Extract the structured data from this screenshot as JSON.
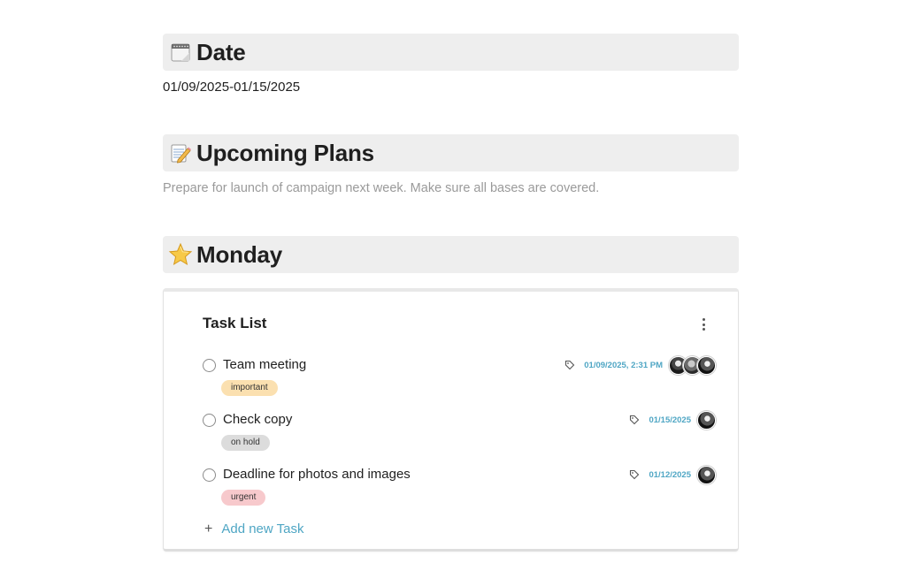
{
  "sections": {
    "date": {
      "title": "Date",
      "icon": "calendar-icon",
      "value": "01/09/2025-01/15/2025"
    },
    "upcoming": {
      "title": "Upcoming Plans",
      "icon": "memo-pencil-icon",
      "text": "Prepare for launch of campaign next week. Make sure all bases are covered."
    },
    "monday": {
      "title": "Monday",
      "icon": "star-icon"
    }
  },
  "task_list": {
    "title": "Task List",
    "menu_icon": "more-vertical-icon",
    "tasks": [
      {
        "name": "Team meeting",
        "tag": "important",
        "date": "01/09/2025, 2:31 PM",
        "assignees": 3
      },
      {
        "name": "Check copy",
        "tag": "on hold",
        "date": "01/15/2025",
        "assignees": 1
      },
      {
        "name": "Deadline for photos and images",
        "tag": "urgent",
        "date": "01/12/2025",
        "assignees": 1
      }
    ],
    "add_label": "Add new Task",
    "add_icon": "plus-icon"
  },
  "colors": {
    "heading_bg": "#eeeeee",
    "accent": "#4fa6c4",
    "tag_important": "#fbe0b0",
    "tag_on_hold": "#dcdcdc",
    "tag_urgent": "#f7c9cc"
  }
}
